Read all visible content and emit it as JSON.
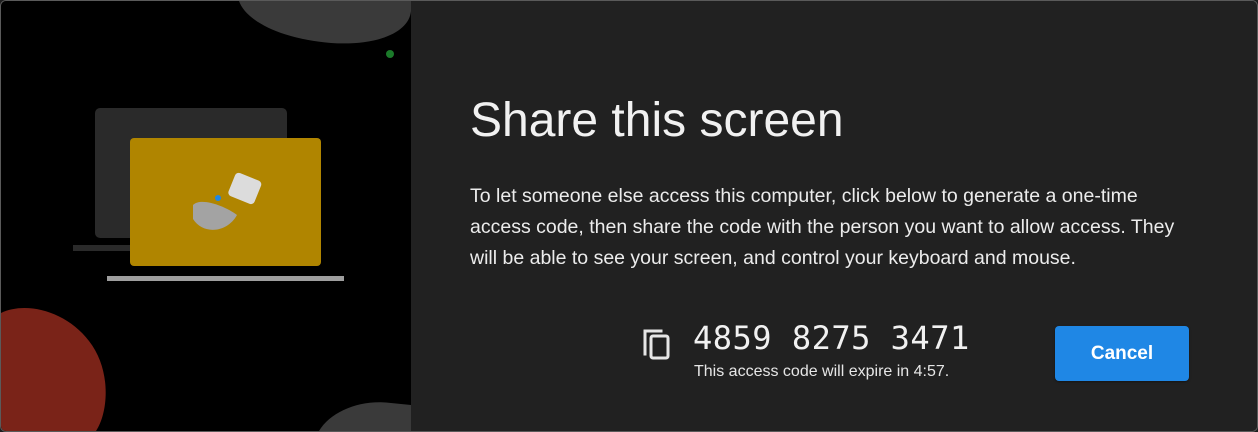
{
  "dialog": {
    "title": "Share this screen",
    "description": "To let someone else access this computer, click below to generate a one-time access code, then share the code with the person you want to allow access. They will be able to see your screen, and control your keyboard and mouse.",
    "access_code": "4859 8275 3471",
    "expiry_text": "This access code will expire in 4:57.",
    "cancel_label": "Cancel",
    "copy_icon": "copy-icon"
  },
  "colors": {
    "accent": "#1f87e5",
    "panel_background": "#212121",
    "illustration_background": "#000000",
    "laptop_screen": "#b08500",
    "blob_red": "#7a2318",
    "dot_green": "#1b7a2a"
  }
}
